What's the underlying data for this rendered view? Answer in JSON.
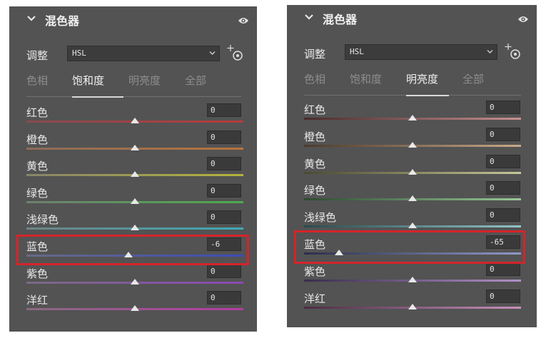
{
  "left": {
    "title": "混色器",
    "adjust_label": "调整",
    "mode_value": "HSL",
    "tabs": [
      {
        "label": "色相",
        "active": false
      },
      {
        "label": "饱和度",
        "active": true
      },
      {
        "label": "明亮度",
        "active": false
      },
      {
        "label": "全部",
        "active": false
      }
    ],
    "rows": [
      {
        "label": "红色",
        "value": "0",
        "slider": 0.5,
        "gradient": [
          "#8a4a50",
          "#b43c3c"
        ]
      },
      {
        "label": "橙色",
        "value": "0",
        "slider": 0.5,
        "gradient": [
          "#8c6c5a",
          "#b8743a"
        ]
      },
      {
        "label": "黄色",
        "value": "0",
        "slider": 0.5,
        "gradient": [
          "#88846a",
          "#b4b43c"
        ]
      },
      {
        "label": "绿色",
        "value": "0",
        "slider": 0.5,
        "gradient": [
          "#6e8070",
          "#4cac4c"
        ]
      },
      {
        "label": "浅绿色",
        "value": "0",
        "slider": 0.5,
        "gradient": [
          "#6e8486",
          "#3caab4"
        ]
      },
      {
        "label": "蓝色",
        "value": "-6",
        "slider": 0.47,
        "gradient": [
          "#686a86",
          "#3c4cb8"
        ]
      },
      {
        "label": "紫色",
        "value": "0",
        "slider": 0.5,
        "gradient": [
          "#7a6a86",
          "#8c48b4"
        ]
      },
      {
        "label": "洋红",
        "value": "0",
        "slider": 0.5,
        "gradient": [
          "#886a80",
          "#b43ca4"
        ]
      }
    ]
  },
  "right": {
    "title": "混色器",
    "adjust_label": "调整",
    "mode_value": "HSL",
    "tabs": [
      {
        "label": "色相",
        "active": false
      },
      {
        "label": "饱和度",
        "active": false
      },
      {
        "label": "明亮度",
        "active": true
      },
      {
        "label": "全部",
        "active": false
      }
    ],
    "rows": [
      {
        "label": "红色",
        "value": "0",
        "slider": 0.5,
        "gradient": [
          "#4a2a2c",
          "#c89090"
        ]
      },
      {
        "label": "橙色",
        "value": "0",
        "slider": 0.5,
        "gradient": [
          "#4c3a2c",
          "#c8a888"
        ]
      },
      {
        "label": "黄色",
        "value": "0",
        "slider": 0.5,
        "gradient": [
          "#4a4a30",
          "#c8c898"
        ]
      },
      {
        "label": "绿色",
        "value": "0",
        "slider": 0.5,
        "gradient": [
          "#2e4a30",
          "#98c898"
        ]
      },
      {
        "label": "浅绿色",
        "value": "0",
        "slider": 0.5,
        "gradient": [
          "#2a4a4c",
          "#90c4c8"
        ]
      },
      {
        "label": "蓝色",
        "value": "-65",
        "slider": 0.16,
        "gradient": [
          "#2c2e4c",
          "#9098c8"
        ]
      },
      {
        "label": "紫色",
        "value": "0",
        "slider": 0.5,
        "gradient": [
          "#3a2c4c",
          "#b090c8"
        ]
      },
      {
        "label": "洋红",
        "value": "0",
        "slider": 0.5,
        "gradient": [
          "#4a2c44",
          "#c890bc"
        ]
      }
    ]
  },
  "colors": {
    "panel_bg": "#535353",
    "highlight": "#d5242a"
  },
  "icons": [
    "chevron-down-icon",
    "eye-icon",
    "dropdown-arrow-icon",
    "target-adjustment-icon"
  ]
}
